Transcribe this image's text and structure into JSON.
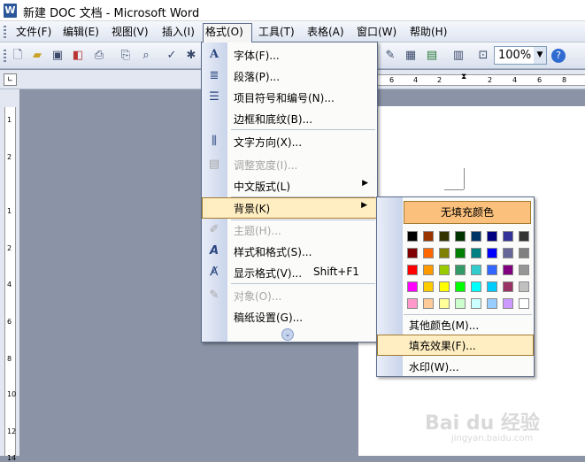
{
  "window": {
    "title": "新建 DOC 文档 - Microsoft Word",
    "app_icon": "W"
  },
  "menubar": {
    "items": [
      {
        "label": "文件(F)"
      },
      {
        "label": "编辑(E)"
      },
      {
        "label": "视图(V)"
      },
      {
        "label": "插入(I)"
      },
      {
        "label": "格式(O)"
      },
      {
        "label": "工具(T)"
      },
      {
        "label": "表格(A)"
      },
      {
        "label": "窗口(W)"
      },
      {
        "label": "帮助(H)"
      }
    ],
    "active": "格式(O)"
  },
  "toolbar": {
    "icons": [
      "new-doc-icon",
      "open-icon",
      "save-icon",
      "permission-icon",
      "print-preview-icon",
      "print-icon",
      "search-icon",
      "spelling-icon",
      "research-icon",
      "table-icon",
      "excel-icon",
      "columns-icon",
      "drawing-icon",
      "zoom-icon",
      "help-icon"
    ],
    "zoom": "100%"
  },
  "ruler": {
    "top_numbers": [
      "6",
      "4",
      "2",
      "2",
      "4",
      "6",
      "8"
    ],
    "left_numbers": [
      "1",
      "2",
      "1",
      "2",
      "4",
      "6",
      "8",
      "10",
      "12",
      "14"
    ]
  },
  "format_menu": {
    "items": [
      {
        "label": "字体(F)...",
        "icon": "font-icon",
        "enabled": true
      },
      {
        "label": "段落(P)...",
        "icon": "paragraph-icon",
        "enabled": true
      },
      {
        "label": "项目符号和编号(N)...",
        "icon": "bullets-icon",
        "enabled": true
      },
      {
        "label": "边框和底纹(B)...",
        "icon": "",
        "enabled": true
      },
      {
        "label": "文字方向(X)...",
        "icon": "text-direction-icon",
        "enabled": true
      },
      {
        "label": "调整宽度(I)...",
        "icon": "fit-width-icon",
        "enabled": false
      },
      {
        "label": "中文版式(L)",
        "icon": "",
        "enabled": true,
        "submenu": true
      },
      {
        "label": "背景(K)",
        "icon": "",
        "enabled": true,
        "submenu": true,
        "highlighted": true
      },
      {
        "label": "主题(H)...",
        "icon": "theme-icon",
        "enabled": false
      },
      {
        "label": "样式和格式(S)...",
        "icon": "styles-icon",
        "enabled": true
      },
      {
        "label": "显示格式(V)...",
        "icon": "reveal-format-icon",
        "enabled": true,
        "shortcut": "Shift+F1"
      },
      {
        "label": "对象(O)...",
        "icon": "object-icon",
        "enabled": false
      },
      {
        "label": "稿纸设置(G)...",
        "icon": "",
        "enabled": true
      }
    ]
  },
  "background_menu": {
    "no_fill": "无填充颜色",
    "swatches": [
      "#000000",
      "#993300",
      "#333300",
      "#003300",
      "#003366",
      "#000080",
      "#333399",
      "#333333",
      "#800000",
      "#FF6600",
      "#808000",
      "#008000",
      "#008080",
      "#0000FF",
      "#666699",
      "#808080",
      "#FF0000",
      "#FF9900",
      "#99CC00",
      "#339966",
      "#33CCCC",
      "#3366FF",
      "#800080",
      "#969696",
      "#FF00FF",
      "#FFCC00",
      "#FFFF00",
      "#00FF00",
      "#00FFFF",
      "#00CCFF",
      "#993366",
      "#C0C0C0",
      "#FF99CC",
      "#FFCC99",
      "#FFFF99",
      "#CCFFCC",
      "#CCFFFF",
      "#99CCFF",
      "#CC99FF",
      "#FFFFFF"
    ],
    "items": [
      {
        "label": "其他颜色(M)..."
      },
      {
        "label": "填充效果(F)...",
        "highlighted": true
      },
      {
        "label": "水印(W)..."
      }
    ]
  },
  "watermark": {
    "text": "Bai du 经验",
    "sub": "jingyan.baidu.com"
  },
  "colors": {
    "highlight": "#ffeec2",
    "no_fill_bg": "#fbc07b",
    "gutter": "#c9d4ea"
  }
}
